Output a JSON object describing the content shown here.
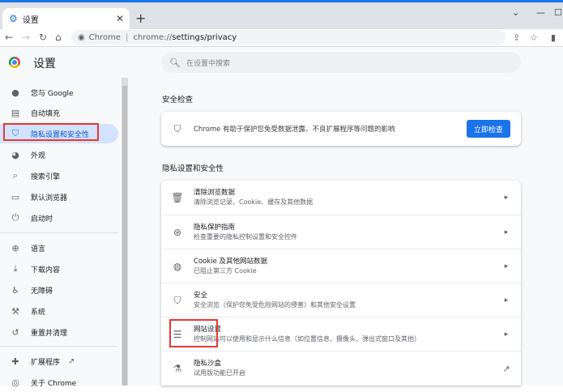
{
  "browser": {
    "tab_title": "设置",
    "omnibox_chip": "Chrome",
    "url_host": "chrome://",
    "url_path": "settings/privacy"
  },
  "app": {
    "title": "设置",
    "search_placeholder": "在设置中搜索"
  },
  "sidebar": {
    "items": [
      {
        "label": "您与 Google",
        "icon": "person-icon"
      },
      {
        "label": "自动填充",
        "icon": "clipboard-icon"
      },
      {
        "label": "隐私设置和安全性",
        "icon": "shield-icon",
        "active": true
      },
      {
        "label": "外观",
        "icon": "palette-icon"
      },
      {
        "label": "搜索引擎",
        "icon": "search-icon"
      },
      {
        "label": "默认浏览器",
        "icon": "browser-icon"
      },
      {
        "label": "启动时",
        "icon": "power-icon"
      },
      {
        "label": "语言",
        "icon": "globe-icon"
      },
      {
        "label": "下载内容",
        "icon": "download-icon"
      },
      {
        "label": "无障碍",
        "icon": "accessibility-icon"
      },
      {
        "label": "系统",
        "icon": "wrench-icon"
      },
      {
        "label": "重置并清理",
        "icon": "history-icon"
      },
      {
        "label": "扩展程序",
        "icon": "puzzle-icon"
      },
      {
        "label": "关于 Chrome",
        "icon": "chrome-icon"
      }
    ]
  },
  "safety_check": {
    "section_title": "安全检查",
    "text": "Chrome 有助于保护您免受数据泄露、不良扩展程序等问题的影响",
    "button": "立即检查"
  },
  "privacy": {
    "section_title": "隐私设置和安全性",
    "rows": [
      {
        "title": "清除浏览数据",
        "subtitle": "清除浏览记录、Cookie、缓存及其他数据",
        "icon": "trash-icon"
      },
      {
        "title": "隐私保护指南",
        "subtitle": "检查重要的隐私控制设置和安全控件",
        "icon": "compass-icon"
      },
      {
        "title": "Cookie 及其他网站数据",
        "subtitle": "已阻止第三方 Cookie",
        "icon": "cookie-icon"
      },
      {
        "title": "安全",
        "subtitle": "安全浏览（保护您免受危险网站的侵害）和其他安全设置",
        "icon": "shield-icon"
      },
      {
        "title": "网站设置",
        "subtitle": "控制网站可以使用和显示什么信息（如位置信息、摄像头、弹出式窗口及其他）",
        "icon": "sliders-icon"
      },
      {
        "title": "隐私沙盒",
        "subtitle": "试用版功能已开启",
        "icon": "flask-icon"
      }
    ]
  },
  "colors": {
    "accent": "#1a73e8",
    "highlight": "#e53935",
    "active_bg": "#d3e3fd"
  }
}
